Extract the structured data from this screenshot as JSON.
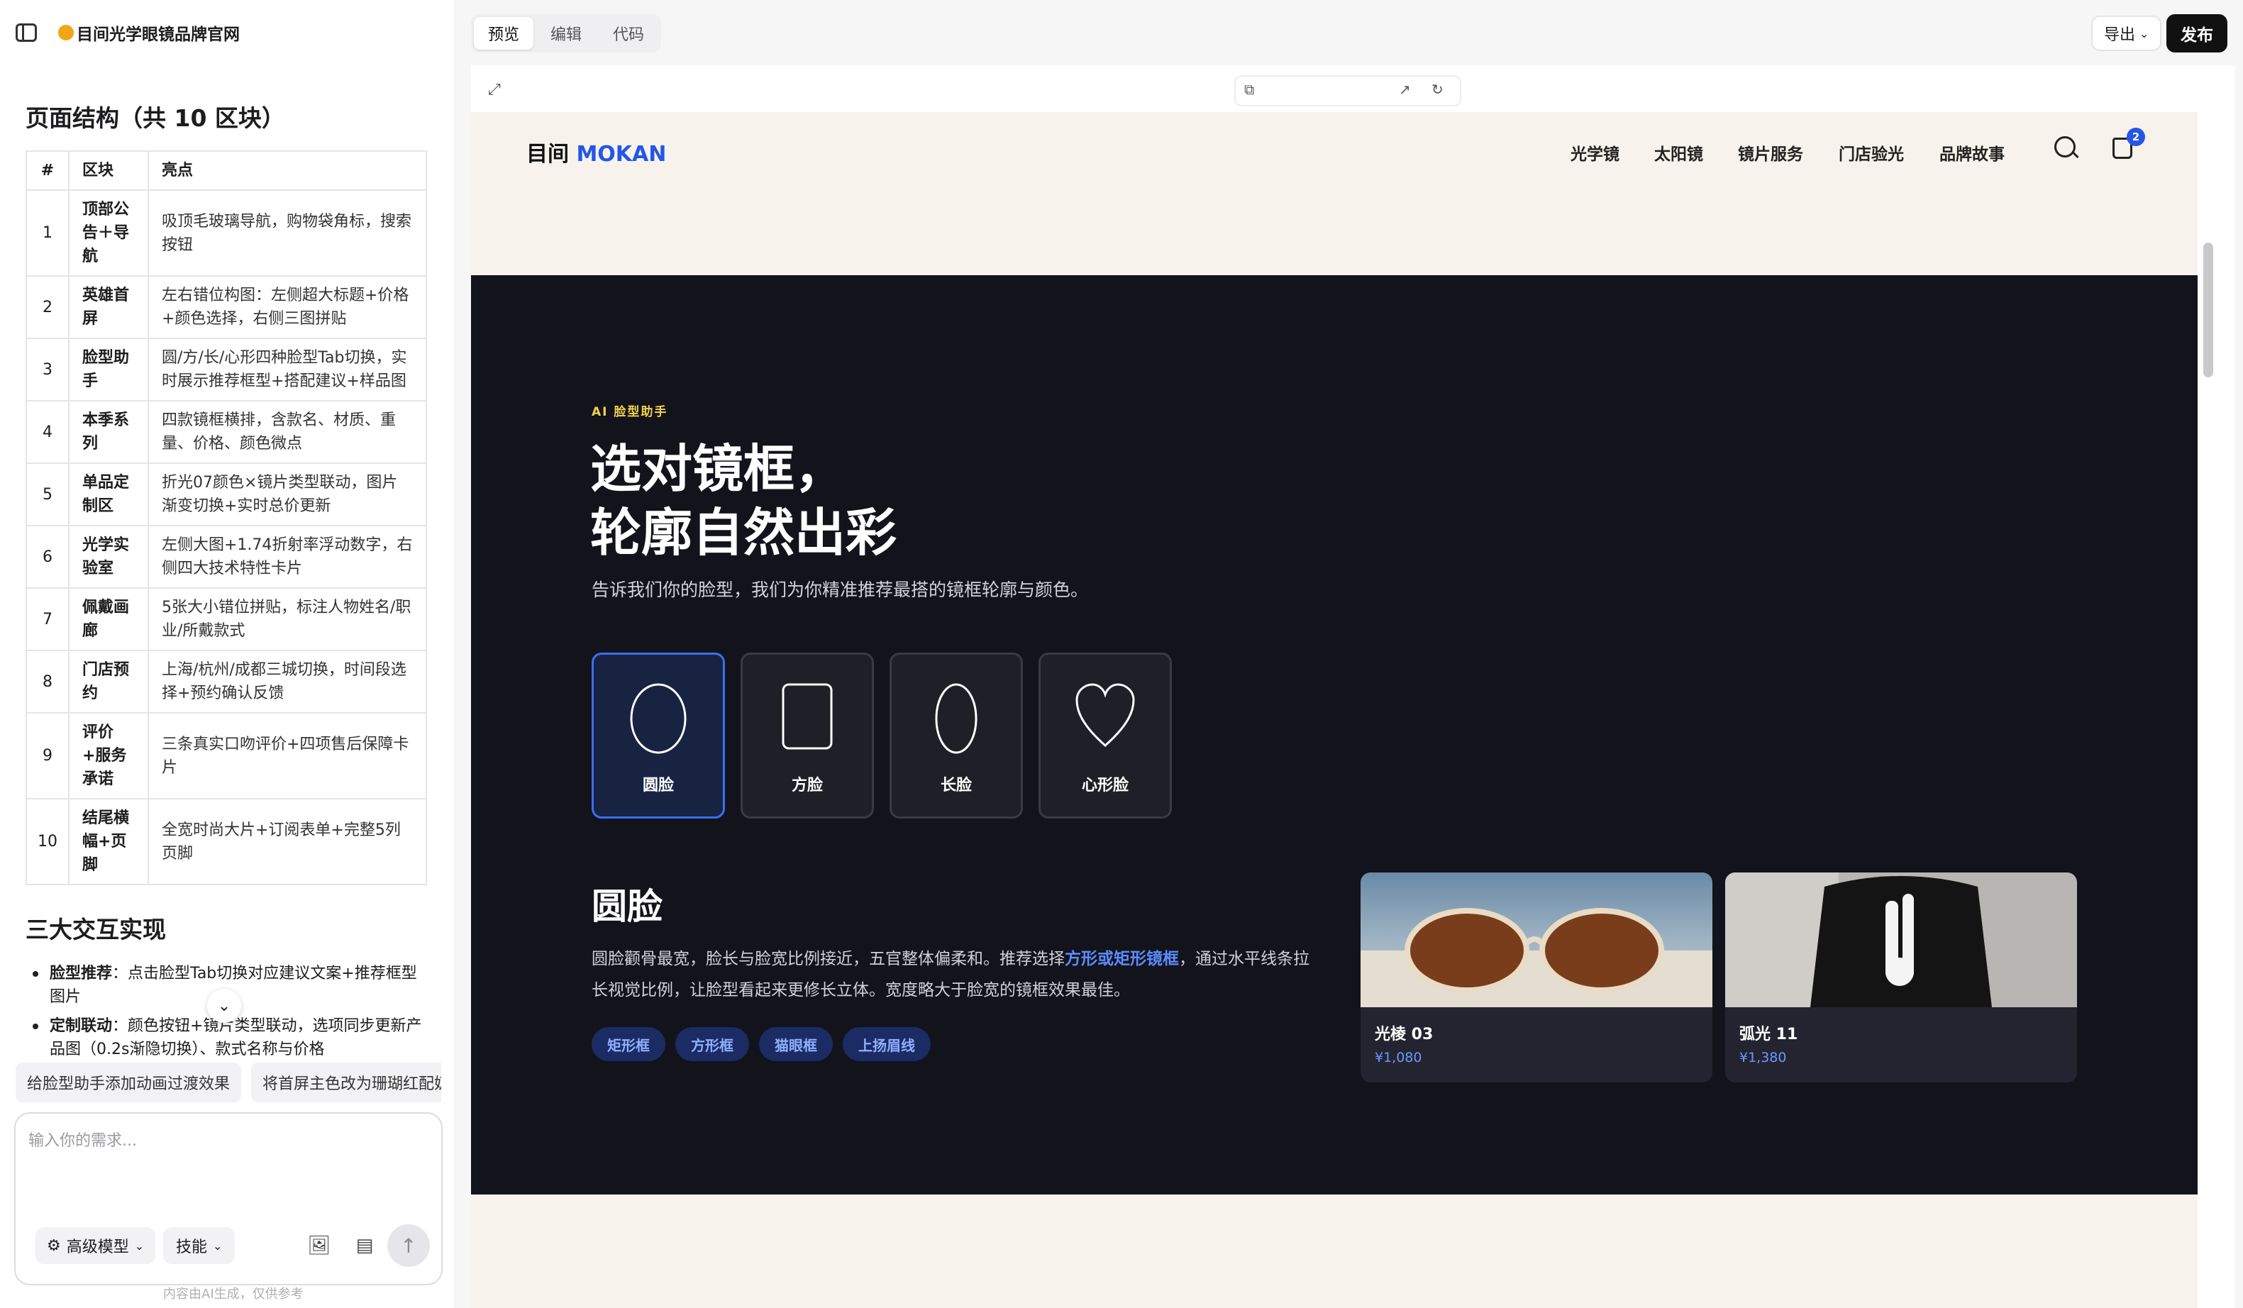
{
  "project": {
    "title": "目间光学眼镜品牌官网"
  },
  "structure": {
    "heading": "页面结构（共 10 区块）",
    "columns": [
      "#",
      "区块",
      "亮点"
    ],
    "rows": [
      {
        "n": "1",
        "block": "顶部公告＋导航",
        "highlight": "吸顶毛玻璃导航，购物袋角标，搜索按钮"
      },
      {
        "n": "2",
        "block": "英雄首屏",
        "highlight": "左右错位构图：左侧超大标题+价格+颜色选择，右侧三图拼贴"
      },
      {
        "n": "3",
        "block": "脸型助手",
        "highlight": "圆/方/长/心形四种脸型Tab切换，实时展示推荐框型+搭配建议+样品图"
      },
      {
        "n": "4",
        "block": "本季系列",
        "highlight": "四款镜框横排，含款名、材质、重量、价格、颜色微点"
      },
      {
        "n": "5",
        "block": "单品定制区",
        "highlight": "折光07颜色×镜片类型联动，图片渐变切换+实时总价更新"
      },
      {
        "n": "6",
        "block": "光学实验室",
        "highlight": "左侧大图+1.74折射率浮动数字，右侧四大技术特性卡片"
      },
      {
        "n": "7",
        "block": "佩戴画廊",
        "highlight": "5张大小错位拼贴，标注人物姓名/职业/所戴款式"
      },
      {
        "n": "8",
        "block": "门店预约",
        "highlight": "上海/杭州/成都三城切换，时间段选择+预约确认反馈"
      },
      {
        "n": "9",
        "block": "评价+服务承诺",
        "highlight": "三条真实口吻评价+四项售后保障卡片"
      },
      {
        "n": "10",
        "block": "结尾横幅+页脚",
        "highlight": "全宽时尚大片+订阅表单+完整5列页脚"
      }
    ]
  },
  "interactions": {
    "heading": "三大交互实现",
    "items": [
      {
        "label": "脸型推荐",
        "text": "：点击脸型Tab切换对应建议文案+推荐框型图片"
      },
      {
        "label": "定制联动",
        "text": "：颜色按钮+镜片类型联动，选项同步更新产品图（0.2s渐隐切换）、款式名称与价格"
      }
    ]
  },
  "suggestions": [
    "给脸型助手添加动画过渡效果",
    "将首屏主色改为珊瑚红配奶油色"
  ],
  "chat": {
    "placeholder": "输入你的需求...",
    "model_label": "高级模型",
    "skill_label": "技能",
    "disclaimer": "内容由AI生成，仅供参考"
  },
  "toolbar": {
    "tabs": [
      "预览",
      "编辑",
      "代码"
    ],
    "active_tab": "预览",
    "export_label": "导出",
    "publish_label": "发布"
  },
  "site": {
    "brand_main": "目间",
    "brand_accent": "MOKAN",
    "nav": [
      "光学镜",
      "太阳镜",
      "镜片服务",
      "门店验光",
      "品牌故事"
    ],
    "cart_count": "2",
    "eyebrow": "AI 脸型助手",
    "title_line1": "选对镜框，",
    "title_line2": "轮廓自然出彩",
    "subtitle": "告诉我们你的脸型，我们为你精准推荐最搭的镜框轮廓与颜色。",
    "faces": [
      "圆脸",
      "方脸",
      "长脸",
      "心形脸"
    ],
    "active_face": "圆脸",
    "selected_title": "圆脸",
    "desc_before": "圆脸颧骨最宽，脸长与脸宽比例接近，五官整体偏柔和。推荐选择",
    "desc_highlight": "方形或矩形镜框",
    "desc_after": "，通过水平线条拉长视觉比例，让脸型看起来更修长立体。宽度略大于脸宽的镜框效果最佳。",
    "tags": [
      "矩形框",
      "方形框",
      "猫眼框",
      "上扬眉线"
    ],
    "products": [
      {
        "name": "光棱 03",
        "price": "¥1,080"
      },
      {
        "name": "弧光 11",
        "price": "¥1,380"
      }
    ]
  },
  "colors": {
    "accent": "#2456e8",
    "dark_bg": "#13131c",
    "eyebrow": "#f2d34a",
    "tag_bg": "#1b2b63"
  }
}
